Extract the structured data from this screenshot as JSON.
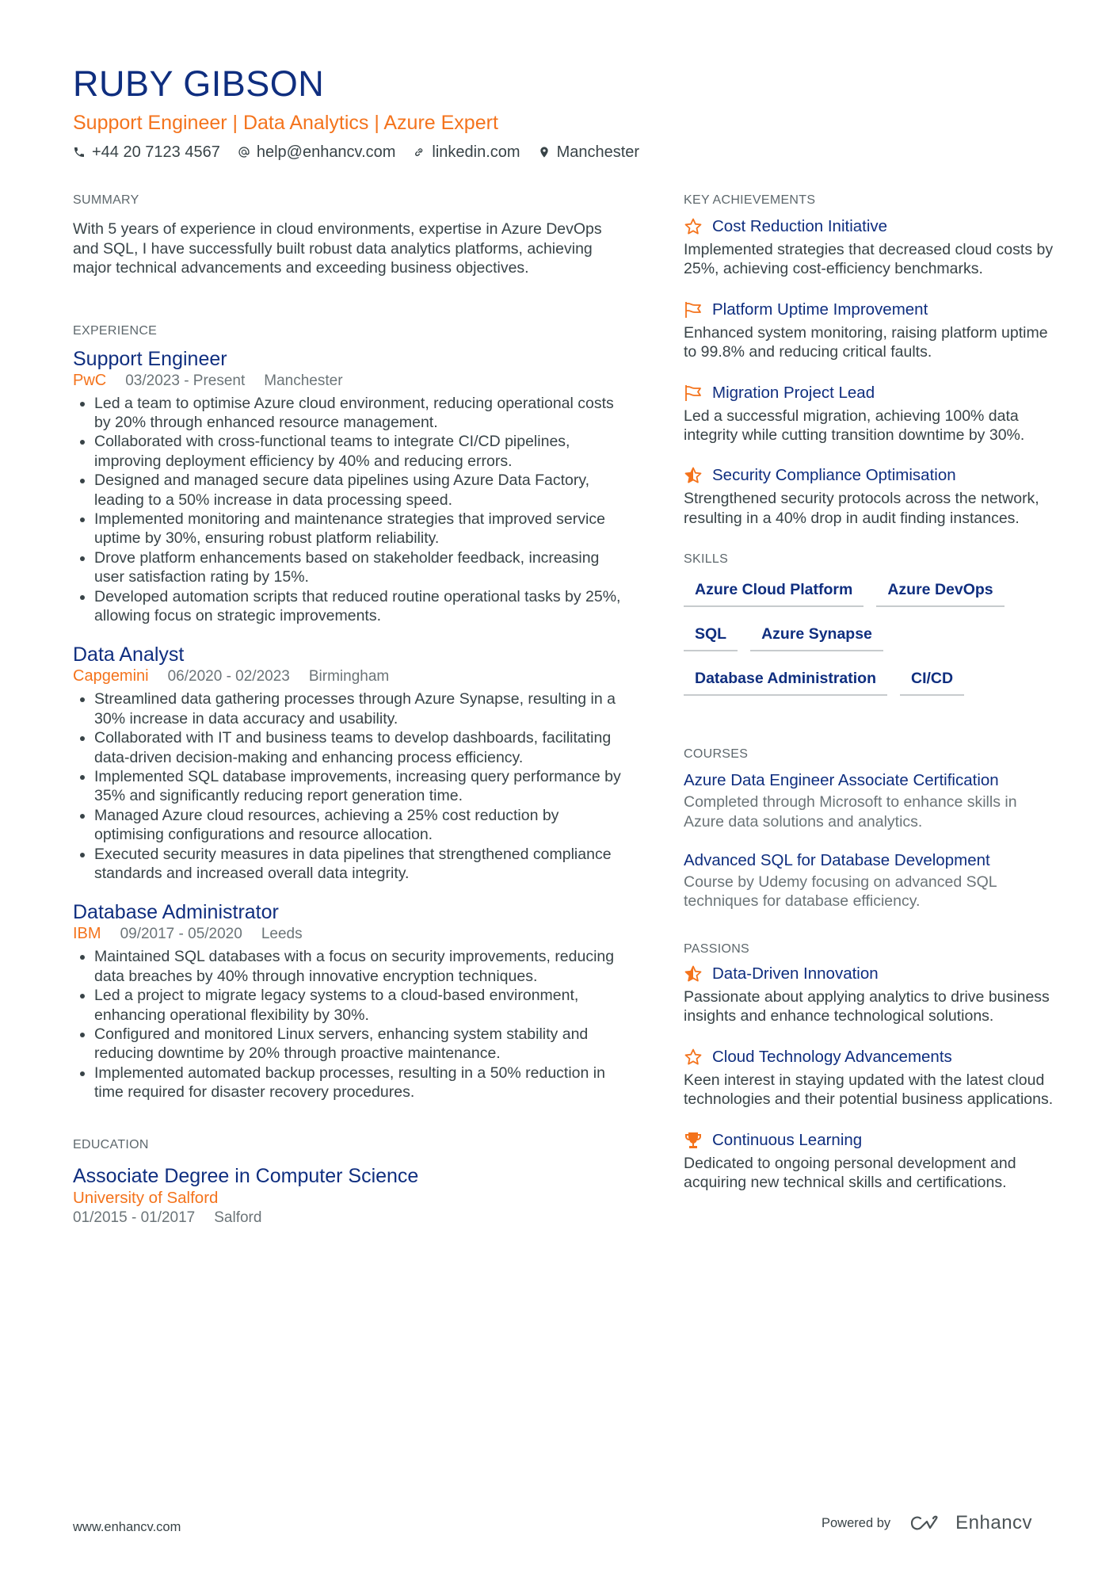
{
  "header": {
    "name": "RUBY GIBSON",
    "headline": "Support Engineer | Data Analytics | Azure Expert",
    "contacts": [
      {
        "icon": "phone-icon",
        "text": "+44 20 7123 4567"
      },
      {
        "icon": "at-icon",
        "text": "help@enhancv.com"
      },
      {
        "icon": "link-icon",
        "text": "linkedin.com"
      },
      {
        "icon": "location-pin-icon",
        "text": "Manchester"
      }
    ]
  },
  "summary": {
    "title": "SUMMARY",
    "text": "With 5 years of experience in cloud environments, expertise in Azure DevOps and SQL, I have successfully built robust data analytics platforms, achieving major technical advancements and exceeding business objectives."
  },
  "experience": {
    "title": "EXPERIENCE",
    "jobs": [
      {
        "title": "Support Engineer",
        "company": "PwC",
        "dates": "03/2023 - Present",
        "location": "Manchester",
        "bullets": [
          "Led a team to optimise Azure cloud environment, reducing operational costs by 20% through enhanced resource management.",
          "Collaborated with cross-functional teams to integrate CI/CD pipelines, improving deployment efficiency by 40% and reducing errors.",
          "Designed and managed secure data pipelines using Azure Data Factory, leading to a 50% increase in data processing speed.",
          "Implemented monitoring and maintenance strategies that improved service uptime by 30%, ensuring robust platform reliability.",
          "Drove platform enhancements based on stakeholder feedback, increasing user satisfaction rating by 15%.",
          "Developed automation scripts that reduced routine operational tasks by 25%, allowing focus on strategic improvements."
        ]
      },
      {
        "title": "Data Analyst",
        "company": "Capgemini",
        "dates": "06/2020 - 02/2023",
        "location": "Birmingham",
        "bullets": [
          "Streamlined data gathering processes through Azure Synapse, resulting in a 30% increase in data accuracy and usability.",
          "Collaborated with IT and business teams to develop dashboards, facilitating data-driven decision-making and enhancing process efficiency.",
          "Implemented SQL database improvements, increasing query performance by 35% and significantly reducing report generation time.",
          "Managed Azure cloud resources, achieving a 25% cost reduction by optimising configurations and resource allocation.",
          "Executed security measures in data pipelines that strengthened compliance standards and increased overall data integrity."
        ]
      },
      {
        "title": "Database Administrator",
        "company": "IBM",
        "dates": "09/2017 - 05/2020",
        "location": "Leeds",
        "bullets": [
          "Maintained SQL databases with a focus on security improvements, reducing data breaches by 40% through innovative encryption techniques.",
          "Led a project to migrate legacy systems to a cloud-based environment, enhancing operational flexibility by 30%.",
          "Configured and monitored Linux servers, enhancing system stability and reducing downtime by 20% through proactive maintenance.",
          "Implemented automated backup processes, resulting in a 50% reduction in time required for disaster recovery procedures."
        ]
      }
    ]
  },
  "education": {
    "title": "EDUCATION",
    "degree": "Associate Degree in Computer Science",
    "school": "University of Salford",
    "dates": "01/2015 - 01/2017",
    "location": "Salford"
  },
  "achievements": {
    "title": "KEY ACHIEVEMENTS",
    "items": [
      {
        "icon": "star-outline-icon",
        "title": "Cost Reduction Initiative",
        "desc": "Implemented strategies that decreased cloud costs by 25%, achieving cost-efficiency benchmarks."
      },
      {
        "icon": "flag-icon",
        "title": "Platform Uptime Improvement",
        "desc": "Enhanced system monitoring, raising platform uptime to 99.8% and reducing critical faults."
      },
      {
        "icon": "flag-icon",
        "title": "Migration Project Lead",
        "desc": "Led a successful migration, achieving 100% data integrity while cutting transition downtime by 30%."
      },
      {
        "icon": "star-half-icon",
        "title": "Security Compliance Optimisation",
        "desc": "Strengthened security protocols across the network, resulting in a 40% drop in audit finding instances."
      }
    ]
  },
  "skills": {
    "title": "SKILLS",
    "items": [
      "Azure Cloud Platform",
      "Azure DevOps",
      "SQL",
      "Azure Synapse",
      "Database Administration",
      "CI/CD"
    ]
  },
  "courses": {
    "title": "COURSES",
    "items": [
      {
        "title": "Azure Data Engineer Associate Certification",
        "desc": "Completed through Microsoft to enhance skills in Azure data solutions and analytics."
      },
      {
        "title": "Advanced SQL for Database Development",
        "desc": "Course by Udemy focusing on advanced SQL techniques for database efficiency."
      }
    ]
  },
  "passions": {
    "title": "PASSIONS",
    "items": [
      {
        "icon": "star-half-icon",
        "title": "Data-Driven Innovation",
        "desc": "Passionate about applying analytics to drive business insights and enhance technological solutions."
      },
      {
        "icon": "star-outline-icon",
        "title": "Cloud Technology Advancements",
        "desc": "Keen interest in staying updated with the latest cloud technologies and their potential business applications."
      },
      {
        "icon": "trophy-icon",
        "title": "Continuous Learning",
        "desc": "Dedicated to ongoing personal development and acquiring new technical skills and certifications."
      }
    ]
  },
  "footer": {
    "website": "www.enhancv.com",
    "powered_by": "Powered by",
    "brand": "Enhancv"
  },
  "colors": {
    "primary": "#0f2e7f",
    "accent": "#f4731c",
    "text": "#384347",
    "muted": "#6b7478"
  }
}
